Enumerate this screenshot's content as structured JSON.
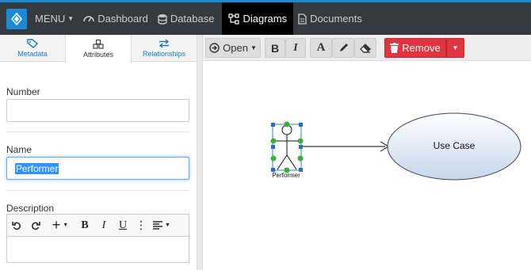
{
  "topbar": {
    "menu_label": "MENU",
    "nav": [
      {
        "label": "Dashboard"
      },
      {
        "label": "Database"
      },
      {
        "label": "Diagrams"
      },
      {
        "label": "Documents"
      }
    ],
    "accent_color": "#1a8ad4"
  },
  "tabs": [
    {
      "label": "Metadata"
    },
    {
      "label": "Attributes"
    },
    {
      "label": "Relationships"
    }
  ],
  "form": {
    "number_label": "Number",
    "number_value": "",
    "name_label": "Name",
    "name_value": "Performer",
    "description_label": "Description",
    "description_value": ""
  },
  "toolbar": {
    "open_label": "Open",
    "remove_label": "Remove",
    "remove_color": "#e0343f"
  },
  "diagram": {
    "actor_label": "Performer",
    "usecase_label": "Use Case"
  }
}
